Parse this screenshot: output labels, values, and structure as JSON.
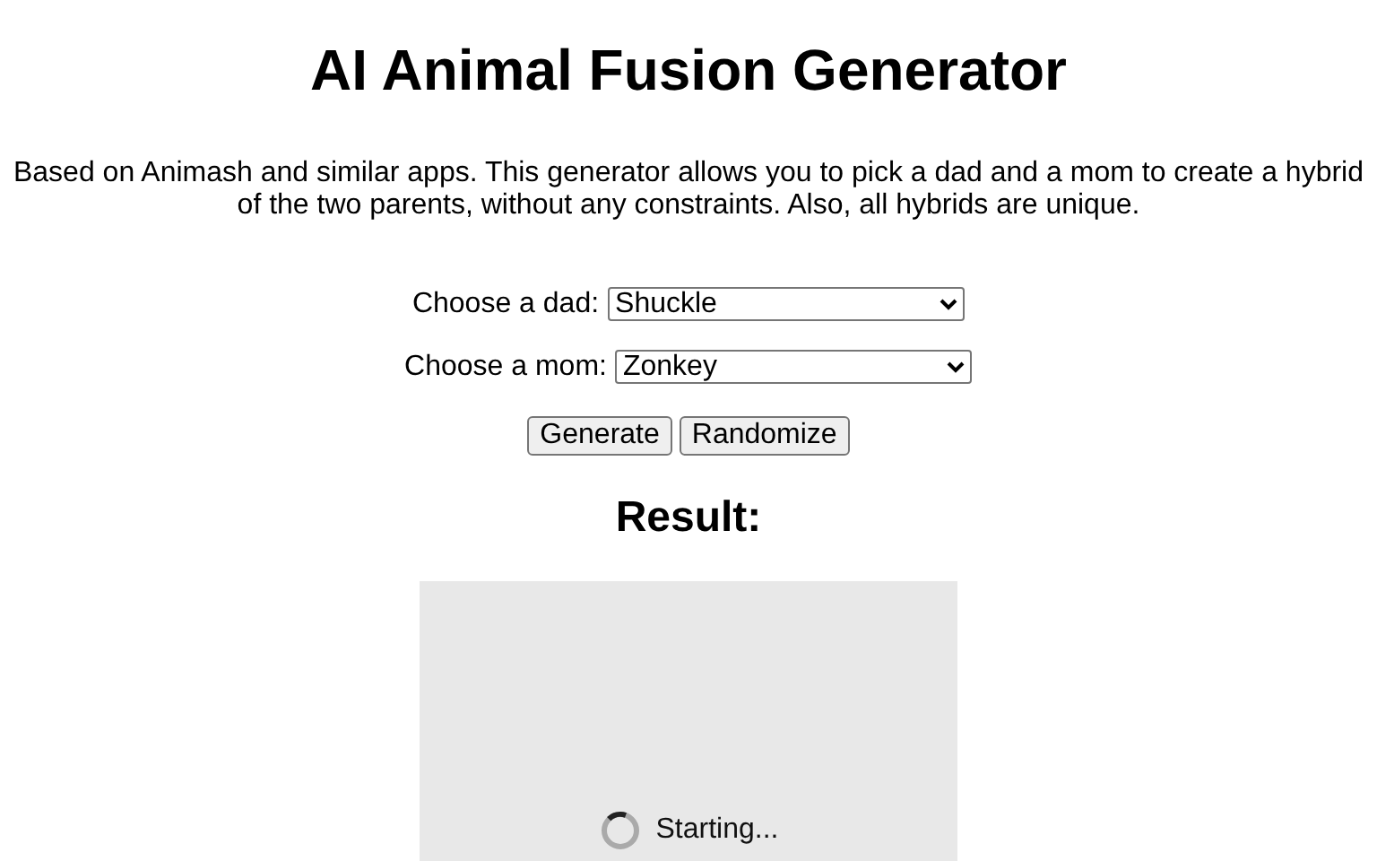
{
  "title": "AI Animal Fusion Generator",
  "description": "Based on Animash and similar apps. This generator allows you to pick a dad and a mom to create a hybrid of the two parents, without any constraints. Also, all hybrids are unique.",
  "selects": [
    {
      "label": "Choose a dad:",
      "value": "Shuckle"
    },
    {
      "label": "Choose a mom:",
      "value": "Zonkey"
    }
  ],
  "buttons": [
    "Generate",
    "Randomize"
  ],
  "result": {
    "heading": "Result:",
    "status": "Starting..."
  }
}
